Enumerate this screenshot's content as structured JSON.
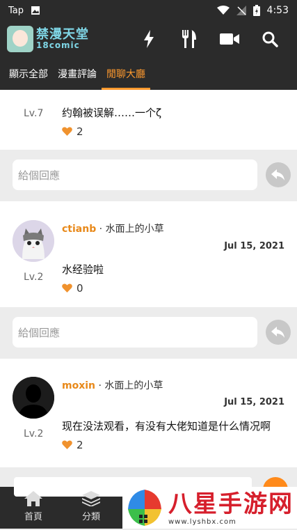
{
  "status": {
    "carrier": "Tap",
    "time": "4:53"
  },
  "app": {
    "logo_cn": "禁漫天堂",
    "logo_en": "18comic"
  },
  "header_icons": [
    "flash-icon",
    "fork-knife-icon",
    "video-camera-icon",
    "search-icon"
  ],
  "tabs": [
    {
      "label": "顯示全部",
      "active": false
    },
    {
      "label": "漫畫評論",
      "active": false
    },
    {
      "label": "閒聊大廳",
      "active": true
    }
  ],
  "comments": [
    {
      "level": "Lv.7",
      "text": "约翰被误解……一个ζ",
      "likes": "2",
      "username": "",
      "board": "",
      "date": ""
    },
    {
      "level": "Lv.2",
      "username": "ctianb",
      "board": " · 水面上的小草",
      "date": "Jul 15, 2021",
      "text": "水经验啦",
      "likes": "0"
    },
    {
      "level": "Lv.2",
      "username": "moxin",
      "board": " · 水面上的小草",
      "date": "Jul 15, 2021",
      "text": "现在没法观看，有没有大佬知道是什么情况啊",
      "likes": "2"
    }
  ],
  "reply_placeholder": "給個回應",
  "bottom_nav": [
    {
      "label": "首頁",
      "icon": "home-icon"
    },
    {
      "label": "分類",
      "icon": "layers-icon"
    }
  ],
  "watermark": {
    "title": "八星手游网",
    "url": "www.lyshbx.com"
  },
  "colors": {
    "accent": "#ff9a2e",
    "username": "#e8891a",
    "heart": "#f0922e",
    "bar": "#2b2b2b"
  }
}
